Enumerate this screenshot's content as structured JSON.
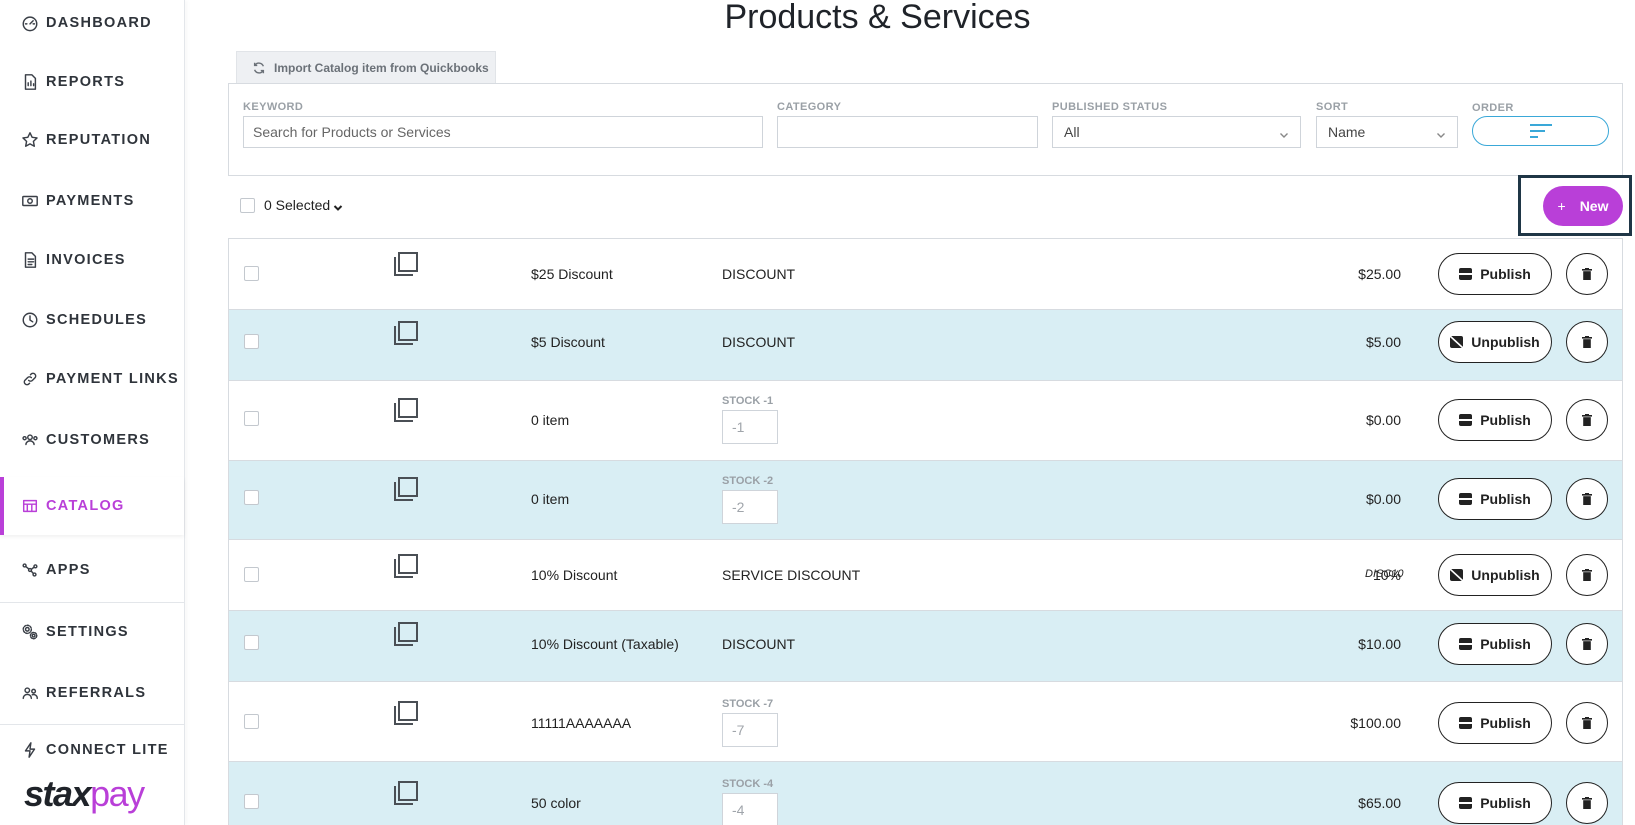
{
  "sidebar": {
    "items": [
      {
        "label": "DASHBOARD",
        "icon": "dashboard-icon"
      },
      {
        "label": "REPORTS",
        "icon": "reports-icon"
      },
      {
        "label": "REPUTATION",
        "icon": "star-icon"
      },
      {
        "label": "PAYMENTS",
        "icon": "payments-icon"
      },
      {
        "label": "INVOICES",
        "icon": "invoice-icon"
      },
      {
        "label": "SCHEDULES",
        "icon": "clock-icon"
      },
      {
        "label": "PAYMENT LINKS",
        "icon": "link-icon"
      },
      {
        "label": "CUSTOMERS",
        "icon": "customers-icon"
      },
      {
        "label": "CATALOG",
        "icon": "catalog-icon",
        "active": true
      },
      {
        "label": "APPS",
        "icon": "apps-icon"
      },
      {
        "label": "SETTINGS",
        "icon": "settings-icon"
      },
      {
        "label": "REFERRALS",
        "icon": "referrals-icon"
      },
      {
        "label": "CONNECT LITE",
        "icon": "lightning-icon"
      }
    ],
    "brand_part1": "stax",
    "brand_part2": "pay",
    "accent_color": "#b93fd8"
  },
  "page": {
    "title": "Products & Services",
    "import_label": "Import Catalog item from Quickbooks"
  },
  "filters": {
    "keyword_label": "KEYWORD",
    "keyword_placeholder": "Search for Products or Services",
    "category_label": "CATEGORY",
    "category_value": "",
    "published_label": "PUBLISHED STATUS",
    "published_value": "All",
    "sort_label": "SORT",
    "sort_value": "Name",
    "order_label": "ORDER"
  },
  "toolbar": {
    "selected_label": "0 Selected",
    "new_label": "New"
  },
  "rows": [
    {
      "name": "$25 Discount",
      "category": "DISCOUNT",
      "price": "$25.00",
      "action": "Publish"
    },
    {
      "name": "$5 Discount",
      "category": "DISCOUNT",
      "price": "$5.00",
      "action": "Unpublish"
    },
    {
      "name": "0 item",
      "stock_label": "STOCK -1",
      "stock_value": "-1",
      "price": "$0.00",
      "action": "Publish"
    },
    {
      "name": "0 item",
      "stock_label": "STOCK -2",
      "stock_value": "-2",
      "price": "$0.00",
      "action": "Publish"
    },
    {
      "name": "10% Discount",
      "category": "SERVICE DISCOUNT",
      "price": "10%",
      "code": "DISC10",
      "action": "Unpublish"
    },
    {
      "name": "10% Discount (Taxable)",
      "category": "DISCOUNT",
      "price": "$10.00",
      "action": "Publish"
    },
    {
      "name": "11111AAAAAAA",
      "stock_label": "STOCK -7",
      "stock_value": "-7",
      "price": "$100.00",
      "action": "Publish"
    },
    {
      "name": "50 color",
      "stock_label": "STOCK -4",
      "stock_value": "-4",
      "price": "$65.00",
      "action": "Publish"
    }
  ]
}
